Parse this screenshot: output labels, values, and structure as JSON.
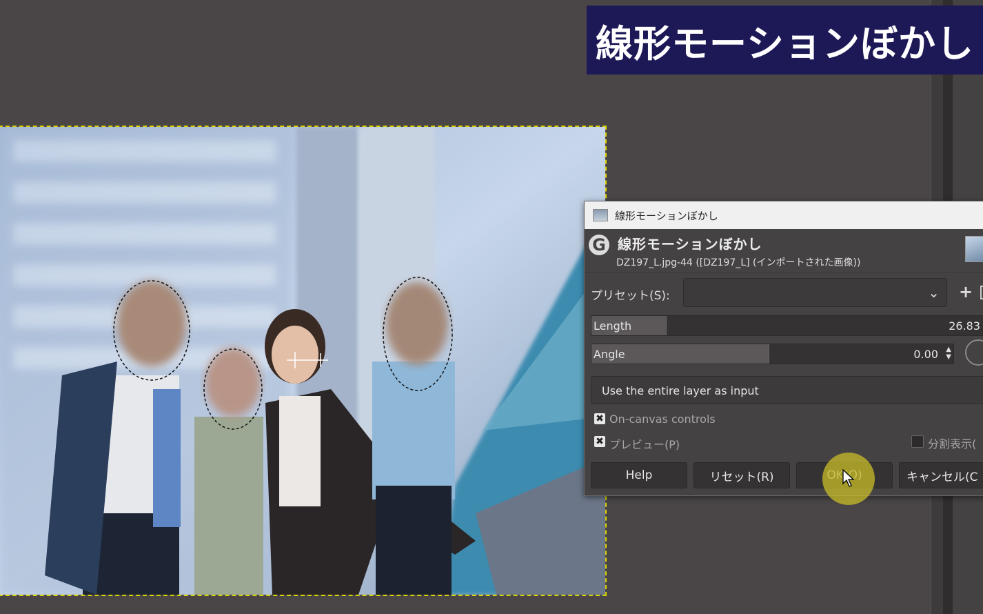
{
  "banner": {
    "title": "線形モーションぼかし"
  },
  "dialog": {
    "window_title": "線形モーションぼかし",
    "header_title": "線形モーションぼかし",
    "header_subtitle": "DZ197_L.jpg-44 ([DZ197_L] (インポートされた画像))",
    "preset_label": "プリセット(S):",
    "preset_value": "",
    "length": {
      "label": "Length",
      "value": "26.83",
      "fill_fraction": 0.19
    },
    "angle": {
      "label": "Angle",
      "value": "0.00",
      "fill_fraction": 0.49
    },
    "input_mode": "Use the entire layer as input",
    "on_canvas_controls": {
      "label": "On-canvas controls",
      "checked": true
    },
    "preview": {
      "label": "プレビュー(P)",
      "checked": true
    },
    "split_view": {
      "label": "分割表示(",
      "checked": false
    },
    "buttons": {
      "help": "Help",
      "reset": "リセット(R)",
      "ok": "OK(O)",
      "cancel": "キャンセル(C"
    }
  },
  "icons": [
    "gimp-logo-icon",
    "chevron-down-icon",
    "plus-icon",
    "checkbox-icon",
    "angle-dial-icon",
    "mouse-pointer-icon"
  ],
  "colors": {
    "banner_bg": "#1d1956",
    "dialog_bg": "#454243",
    "selection_marquee": "#d8d200",
    "click_highlight": "#c8be28"
  }
}
